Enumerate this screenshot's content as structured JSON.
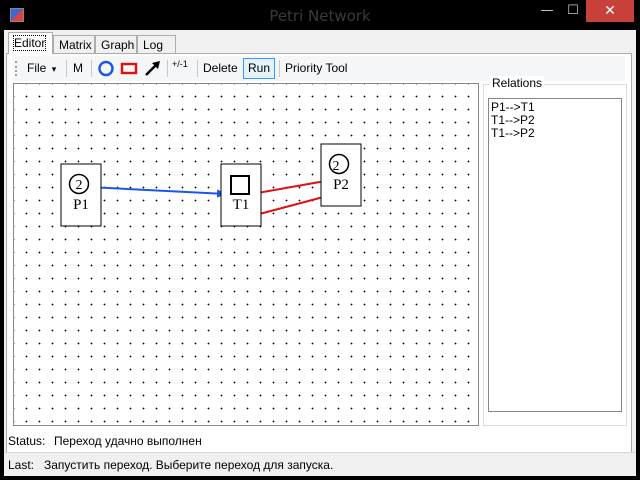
{
  "window": {
    "title": "Petri Network",
    "min_glyph": "—",
    "max_glyph": "☐",
    "close_glyph": "✕"
  },
  "tabs": [
    "Editor",
    "Matrix",
    "Graph",
    "Log"
  ],
  "active_tab": "Editor",
  "toolbar": {
    "file_label": "File",
    "file_arrow": "▾",
    "marker_label": "M",
    "place_tool_icon": "circle-tool-icon",
    "transition_tool_icon": "rectangle-tool-icon",
    "arc_tool_icon": "arrow-tool-icon",
    "counter_tool_label": "+/-1",
    "delete_label": "Delete",
    "run_label": "Run",
    "priority_label": "Priority Tool",
    "accent_blue": "#1a56e8",
    "accent_red": "#e01010"
  },
  "net": {
    "places": [
      {
        "name": "P1",
        "tokens": "2"
      },
      {
        "name": "P2",
        "tokens": "2"
      }
    ],
    "transitions": [
      {
        "name": "T1"
      }
    ]
  },
  "relations": {
    "title": "Relations",
    "items": [
      "P1-->T1",
      "T1-->P2",
      "T1-->P2"
    ]
  },
  "status": {
    "label": "Status:",
    "text": "Переход удачно выполнен"
  },
  "last": {
    "label": "Last:",
    "text": "Запустить переход. Выберите переход для запуска."
  }
}
